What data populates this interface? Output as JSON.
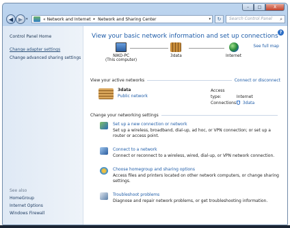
{
  "window": {
    "minimize": "–",
    "maximize": "□",
    "close": "X"
  },
  "toolbar": {
    "back": "◀",
    "forward": "▶",
    "nav_dropdown": "▾",
    "breadcrumb": [
      "«",
      "Network and Internet",
      "▸",
      "Network and Sharing Center"
    ],
    "address_dropdown": "▾",
    "refresh": "↻",
    "search_placeholder": "Search Control Panel",
    "search_icon": "⌕"
  },
  "sidebar": {
    "home": "Control Panel Home",
    "links": [
      "Change adapter settings",
      "Change advanced sharing settings"
    ],
    "see_also_heading": "See also",
    "see_also": [
      "HomeGroup",
      "Internet Options",
      "Windows Firewall"
    ]
  },
  "main": {
    "help": "?",
    "title": "View your basic network information and set up connections",
    "full_map": "See full map",
    "nodes": {
      "computer": "NIKO-PC",
      "computer_sub": "(This computer)",
      "network": "3data",
      "internet": "Internet"
    },
    "active_header": "View your active networks",
    "connect_link": "Connect or disconnect",
    "active_network": {
      "name": "3data",
      "type": "Public network",
      "access_label": "Access type:",
      "access_value": "Internet",
      "connections_label": "Connections:",
      "connections_value": "3data"
    },
    "change_header": "Change your networking settings",
    "tasks": [
      {
        "title": "Set up a new connection or network",
        "desc": "Set up a wireless, broadband, dial-up, ad hoc, or VPN connection; or set up a router or access point."
      },
      {
        "title": "Connect to a network",
        "desc": "Connect or reconnect to a wireless, wired, dial-up, or VPN network connection."
      },
      {
        "title": "Choose homegroup and sharing options",
        "desc": "Access files and printers located on other network computers, or change sharing settings."
      },
      {
        "title": "Troubleshoot problems",
        "desc": "Diagnose and repair network problems, or get troubleshooting information."
      }
    ]
  },
  "colors": {
    "link": "#1e5ca8",
    "title": "#1e5ca8",
    "sidebar_bg": "#dfe9f5",
    "frame": "#a9c3e2"
  }
}
